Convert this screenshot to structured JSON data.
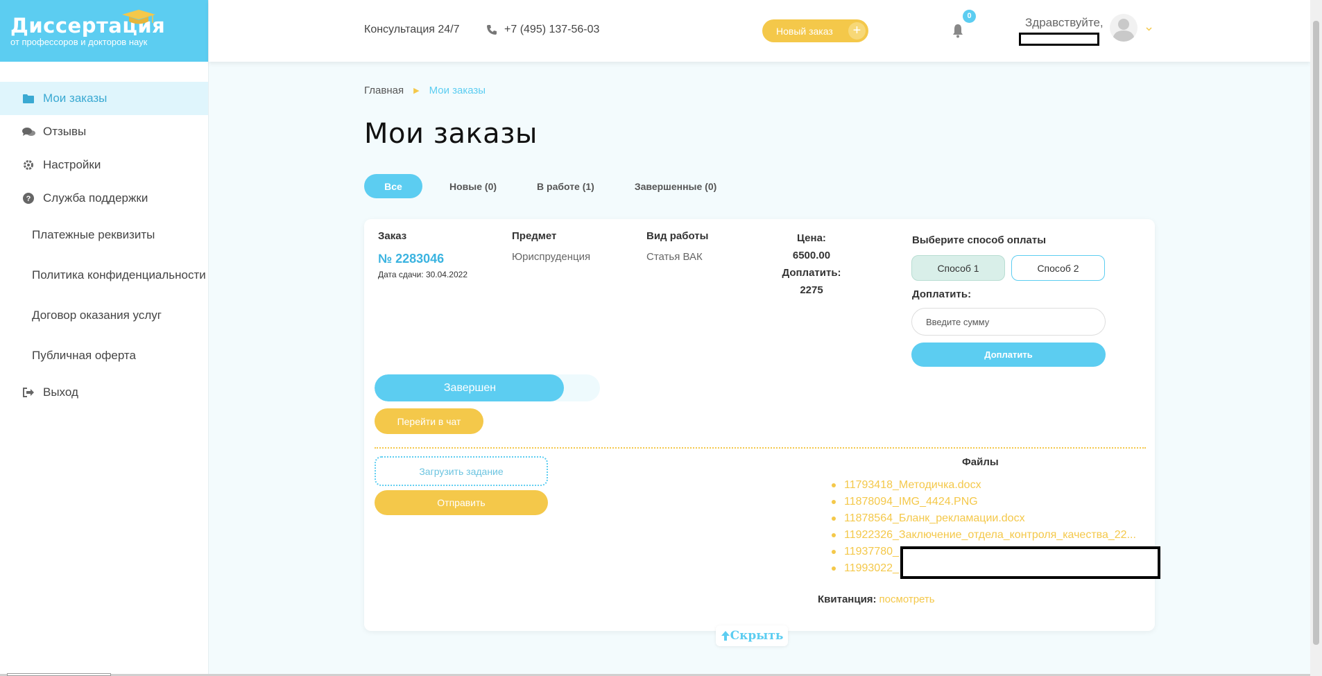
{
  "brand": {
    "name": "Диссертация",
    "tagline": "от профессоров и докторов наук"
  },
  "sidebar": {
    "items": [
      {
        "label": "Мои заказы",
        "icon": "folder-icon"
      },
      {
        "label": "Отзывы",
        "icon": "comments-icon"
      },
      {
        "label": "Настройки",
        "icon": "gear-icon"
      },
      {
        "label": "Служба поддержки",
        "icon": "question-circle-icon"
      },
      {
        "label": "Платежные реквизиты"
      },
      {
        "label": "Политика конфиденциальности"
      },
      {
        "label": "Договор оказания услуг"
      },
      {
        "label": "Публичная оферта"
      },
      {
        "label": "Выход",
        "icon": "sign-out-icon"
      }
    ]
  },
  "header": {
    "consult": "Консультация 24/7",
    "phone": "+7 (495) 137-56-03",
    "new_order": "Новый заказ",
    "new_order_plus": "+",
    "notif_count": "0",
    "greeting": "Здравствуйте,"
  },
  "breadcrumb": {
    "home": "Главная",
    "current": "Мои заказы"
  },
  "page_title": "Мои заказы",
  "tabs": [
    {
      "label": "Все"
    },
    {
      "label": "Новые (0)"
    },
    {
      "label": "В работе (1)"
    },
    {
      "label": "Завершенные (0)"
    }
  ],
  "order": {
    "h_order": "Заказ",
    "h_subject": "Предмет",
    "h_work": "Вид работы",
    "h_price": "Цена:",
    "number": "№ 2283046",
    "due": "Дата сдачи: 30.04.2022",
    "subject": "Юриспруденция",
    "work_type": "Статья ВАК",
    "price": "6500.00 ",
    "surcharge_label": "Доплатить:",
    "surcharge": "2275 ",
    "status": "Завершен",
    "status_progress_pct": 84,
    "chat": "Перейти в чат"
  },
  "payment": {
    "title": "Выберите способ оплаты",
    "method1": "Способ 1",
    "method2": "Способ 2",
    "amount_label": "Доплатить:",
    "amount_placeholder": "Введите сумму",
    "submit": "Доплатить"
  },
  "upload": {
    "upload_label": "Загрузить задание",
    "send_label": "Отправить"
  },
  "files": {
    "title": "Файлы",
    "items": [
      "11793418_Методичка.docx",
      "11878094_IMG_4424.PNG",
      "11878564_Бланк_рекламации.docx",
      "11922326_Заключение_отдела_контроля_качества_22...",
      "11937780_",
      "11993022_"
    ],
    "receipt_label": "Квитанция:",
    "receipt_link": "посмотреть"
  },
  "hide": {
    "label": "Скрыть"
  },
  "colors": {
    "accent": "#5ccdf1",
    "yellow": "#f4c84a"
  }
}
